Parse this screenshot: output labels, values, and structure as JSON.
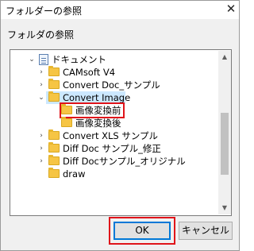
{
  "window": {
    "title": "フォルダーの参照",
    "close_glyph": "✕"
  },
  "prompt": "フォルダの参照",
  "tree": {
    "items": [
      {
        "label": "ドキュメント",
        "icon": "document-library-icon",
        "expander": "expanded"
      },
      {
        "label": "CAMsoft V4",
        "icon": "folder-icon",
        "expander": "collapsed"
      },
      {
        "label": "Convert Doc_サンプル",
        "icon": "folder-icon",
        "expander": "collapsed"
      },
      {
        "label": "Convert Image",
        "icon": "folder-icon",
        "expander": "expanded",
        "selected": true
      },
      {
        "label": "画像変換前",
        "icon": "folder-icon",
        "expander": "none",
        "highlighted": true
      },
      {
        "label": "画像変換後",
        "icon": "folder-icon",
        "expander": "none"
      },
      {
        "label": "Convert XLS サンプル",
        "icon": "folder-icon",
        "expander": "collapsed"
      },
      {
        "label": "Diff Doc サンプル_修正",
        "icon": "folder-icon",
        "expander": "collapsed"
      },
      {
        "label": "Diff Docサンプル_オリジナル",
        "icon": "folder-icon",
        "expander": "collapsed"
      },
      {
        "label": "draw",
        "icon": "folder-icon",
        "expander": "none"
      }
    ],
    "scroll": {
      "up_glyph": "▲",
      "down_glyph": "▼"
    }
  },
  "buttons": {
    "ok": "OK",
    "cancel": "キャンセル"
  },
  "colors": {
    "selection": "#cce8ff",
    "highlight_box": "#e0141a",
    "default_button_border": "#0078d7"
  }
}
